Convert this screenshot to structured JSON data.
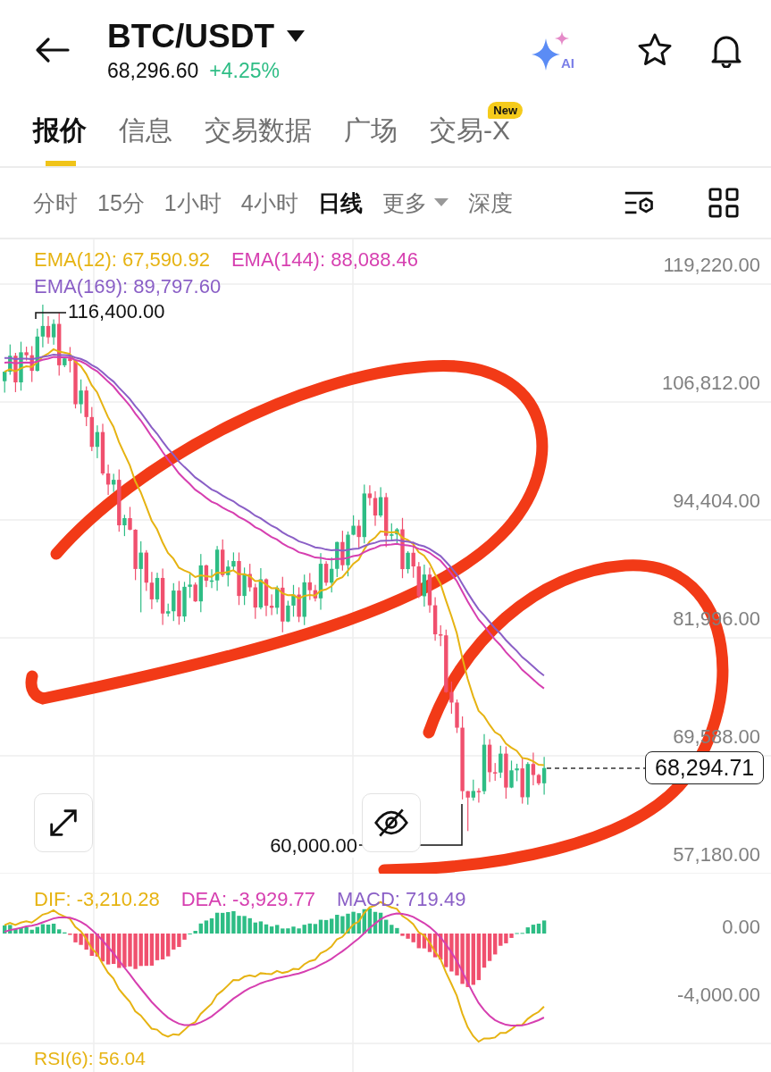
{
  "header": {
    "pair": "BTC/USDT",
    "price": "68,296.60",
    "change": "+4.25%",
    "ai_label": "AI"
  },
  "tabs": [
    {
      "label": "报价",
      "selected": true
    },
    {
      "label": "信息",
      "selected": false
    },
    {
      "label": "交易数据",
      "selected": false
    },
    {
      "label": "广场",
      "selected": false
    },
    {
      "label": "交易-X",
      "selected": false,
      "badge": "New"
    }
  ],
  "intervals": [
    {
      "label": "分时",
      "selected": false,
      "kind": "text"
    },
    {
      "label": "15分",
      "selected": false,
      "kind": "text"
    },
    {
      "label": "1小时",
      "selected": false,
      "kind": "text"
    },
    {
      "label": "4小时",
      "selected": false,
      "kind": "text"
    },
    {
      "label": "日线",
      "selected": true,
      "kind": "text"
    },
    {
      "label": "更多",
      "selected": false,
      "kind": "dropdown"
    },
    {
      "label": "深度",
      "selected": false,
      "kind": "text"
    }
  ],
  "chart": {
    "legend": [
      {
        "label": "EMA(12): 67,590.92",
        "color": "#e6b312"
      },
      {
        "label": "EMA(144): 88,088.46",
        "color": "#d63fb0"
      },
      {
        "label": "EMA(169): 89,797.60",
        "color": "#8a5fc6"
      }
    ],
    "y_labels": [
      "119,220.00",
      "106,812.00",
      "94,404.00",
      "81,996.00",
      "69,588.00",
      "57,180.00"
    ],
    "high_label": "116,400.00",
    "low_label": "60,000.00",
    "price_tag": "68,294.71"
  },
  "macd": {
    "legend": [
      {
        "label": "DIF: -3,210.28",
        "color": "#e6b312"
      },
      {
        "label": "DEA: -3,929.77",
        "color": "#d63fb0"
      },
      {
        "label": "MACD: 719.49",
        "color": "#8a5fc6"
      }
    ],
    "y_labels": [
      "0.00",
      "-4,000.00"
    ]
  },
  "rsi": {
    "label": "RSI(6): 56.04"
  }
}
